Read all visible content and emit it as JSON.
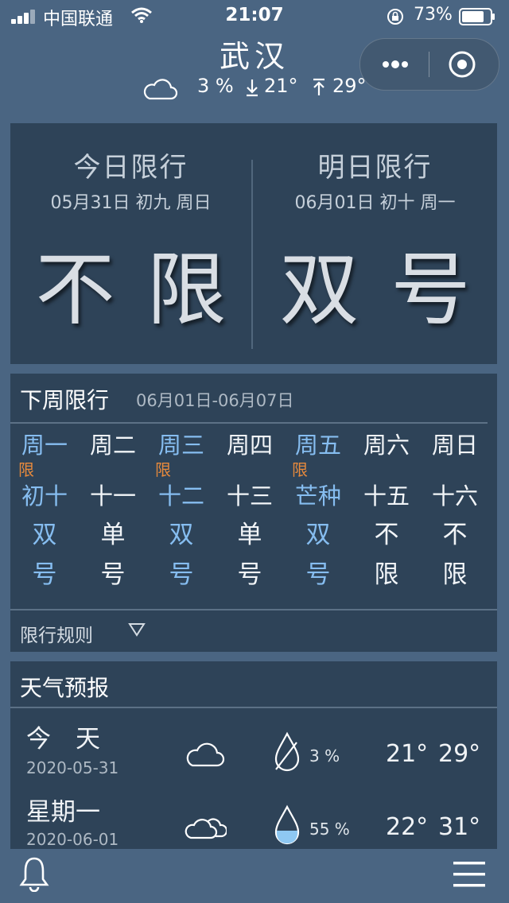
{
  "status_bar": {
    "carrier": "中国联通",
    "time": "21:07",
    "battery": "73%"
  },
  "header": {
    "city": "武汉",
    "weather_icon": "cloud-icon",
    "precip": "3 %",
    "low": "21°",
    "high": "29°"
  },
  "today": {
    "title": "今日限行",
    "date": "05月31日 初九 周日",
    "value": "不限"
  },
  "tomorrow": {
    "title": "明日限行",
    "date": "06月01日 初十 周一",
    "value": "双号"
  },
  "next_week": {
    "title": "下周限行",
    "range": "06月01日-06月07日",
    "days": [
      {
        "day": "周一",
        "limit": "限",
        "lunar": "初十",
        "r1": "双",
        "r2": "号",
        "restricted": true
      },
      {
        "day": "周二",
        "limit": "",
        "lunar": "十一",
        "r1": "单",
        "r2": "号",
        "restricted": false
      },
      {
        "day": "周三",
        "limit": "限",
        "lunar": "十二",
        "r1": "双",
        "r2": "号",
        "restricted": true
      },
      {
        "day": "周四",
        "limit": "",
        "lunar": "十三",
        "r1": "单",
        "r2": "号",
        "restricted": false
      },
      {
        "day": "周五",
        "limit": "限",
        "lunar": "芒种",
        "r1": "双",
        "r2": "号",
        "restricted": true
      },
      {
        "day": "周六",
        "limit": "",
        "lunar": "十五",
        "r1": "不",
        "r2": "限",
        "restricted": false
      },
      {
        "day": "周日",
        "limit": "",
        "lunar": "十六",
        "r1": "不",
        "r2": "限",
        "restricted": false
      }
    ],
    "rules_label": "限行规则"
  },
  "forecast": {
    "title": "天气预报",
    "items": [
      {
        "name": "今　天",
        "date": "2020-05-31",
        "icon": "cloud-icon",
        "drop_icon": "no-rain-drop-icon",
        "precip": "3 %",
        "low": "21°",
        "high": "29°"
      },
      {
        "name": "星期一",
        "date": "2020-06-01",
        "icon": "clouds-icon",
        "drop_icon": "rain-drop-icon",
        "precip": "55 %",
        "low": "22°",
        "high": "31°"
      }
    ]
  },
  "colors": {
    "background": "#4a6582",
    "panel": "#2e4358",
    "restricted_day": "#86bdf0",
    "limit_tag": "#e88a3c"
  }
}
